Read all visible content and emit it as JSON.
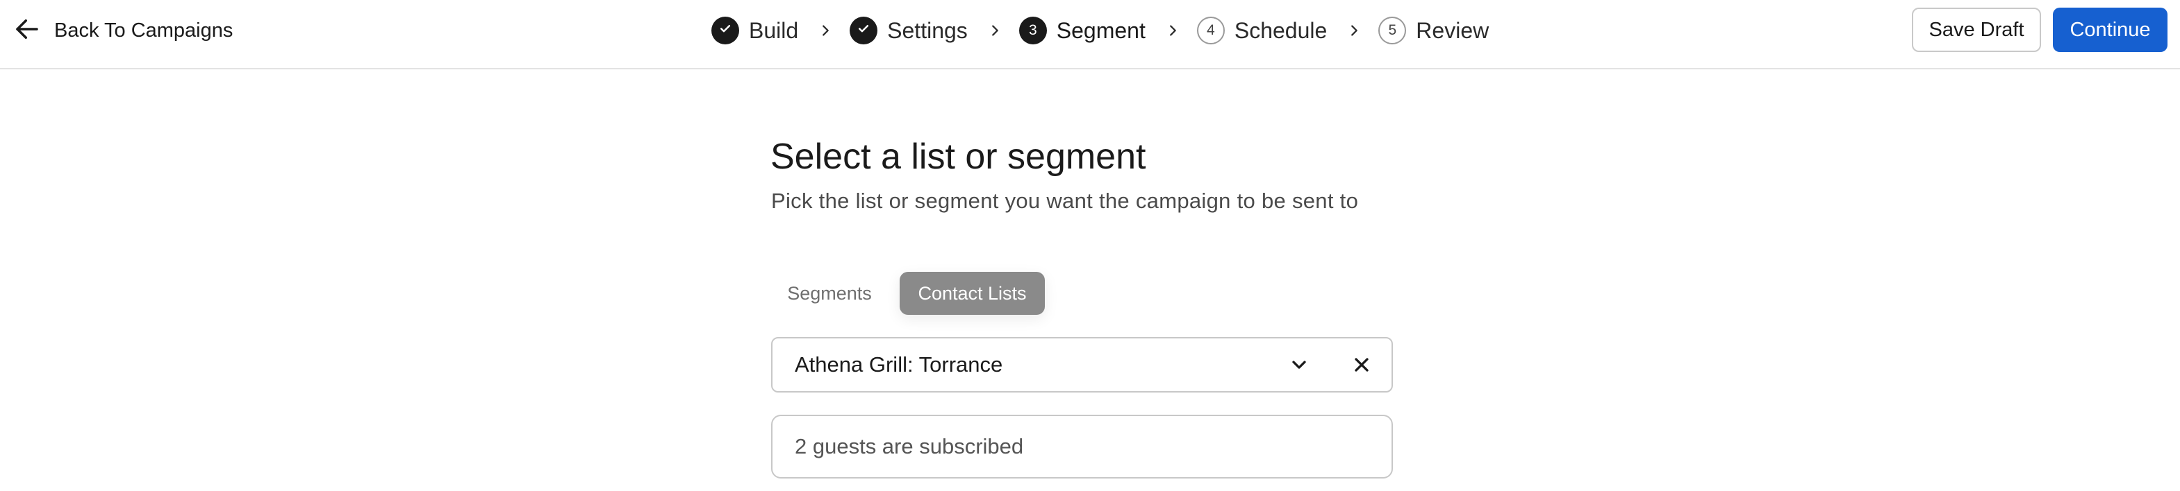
{
  "header": {
    "back_label": "Back To Campaigns",
    "save_draft_label": "Save Draft",
    "continue_label": "Continue",
    "continue_color": "#1660d0"
  },
  "steps": [
    {
      "number": "",
      "label": "Build",
      "state": "done",
      "icon": "check-icon"
    },
    {
      "number": "",
      "label": "Settings",
      "state": "done",
      "icon": "check-icon"
    },
    {
      "number": "3",
      "label": "Segment",
      "state": "active"
    },
    {
      "number": "4",
      "label": "Schedule",
      "state": "todo"
    },
    {
      "number": "5",
      "label": "Review",
      "state": "todo"
    }
  ],
  "main": {
    "title": "Select a list or segment",
    "subtitle": "Pick the list or segment you want the campaign to be sent to",
    "tabs": [
      {
        "label": "Segments",
        "selected": false
      },
      {
        "label": "Contact Lists",
        "selected": true
      }
    ],
    "select": {
      "value": "Athena Grill: Torrance"
    },
    "subscribed_text": "2 guests are subscribed"
  }
}
